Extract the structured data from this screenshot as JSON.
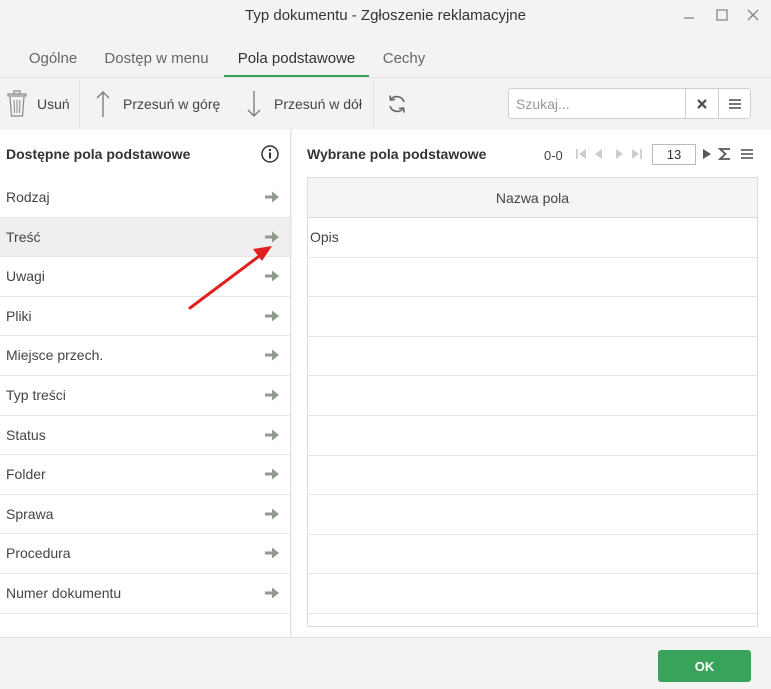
{
  "window": {
    "title": "Typ dokumentu - Zgłoszenie reklamacyjne"
  },
  "tabs": [
    {
      "label": "Ogólne",
      "active": false
    },
    {
      "label": "Dostęp w menu",
      "active": false
    },
    {
      "label": "Pola podstawowe",
      "active": true
    },
    {
      "label": "Cechy",
      "active": false
    }
  ],
  "toolbar": {
    "delete_label": "Usuń",
    "move_up_label": "Przesuń w górę",
    "move_down_label": "Przesuń w dół",
    "search_placeholder": "Szukaj...",
    "search_value": ""
  },
  "available_fields": {
    "title": "Dostępne pola podstawowe",
    "items": [
      {
        "label": "Rodzaj"
      },
      {
        "label": "Treść"
      },
      {
        "label": "Uwagi"
      },
      {
        "label": "Pliki"
      },
      {
        "label": "Miejsce przech."
      },
      {
        "label": "Typ treści"
      },
      {
        "label": "Status"
      },
      {
        "label": "Folder"
      },
      {
        "label": "Sprawa"
      },
      {
        "label": "Procedura"
      },
      {
        "label": "Numer dokumentu"
      }
    ]
  },
  "selected_fields": {
    "title": "Wybrane pola podstawowe",
    "range": "0-0",
    "page_size": "13",
    "column_header": "Nazwa pola",
    "rows": [
      {
        "name": "Opis"
      }
    ]
  },
  "footer": {
    "ok_label": "OK"
  },
  "colors": {
    "accent": "#3aa35a",
    "annotation_arrow": "#e02020"
  },
  "icons": {
    "delete": "trash-icon",
    "move_up": "arrow-up-icon",
    "move_down": "arrow-down-icon",
    "refresh": "refresh-icon",
    "clear": "clear-icon",
    "menu": "menu-icon",
    "info": "info-icon",
    "add": "arrow-right-icon",
    "sum": "sum-icon"
  }
}
